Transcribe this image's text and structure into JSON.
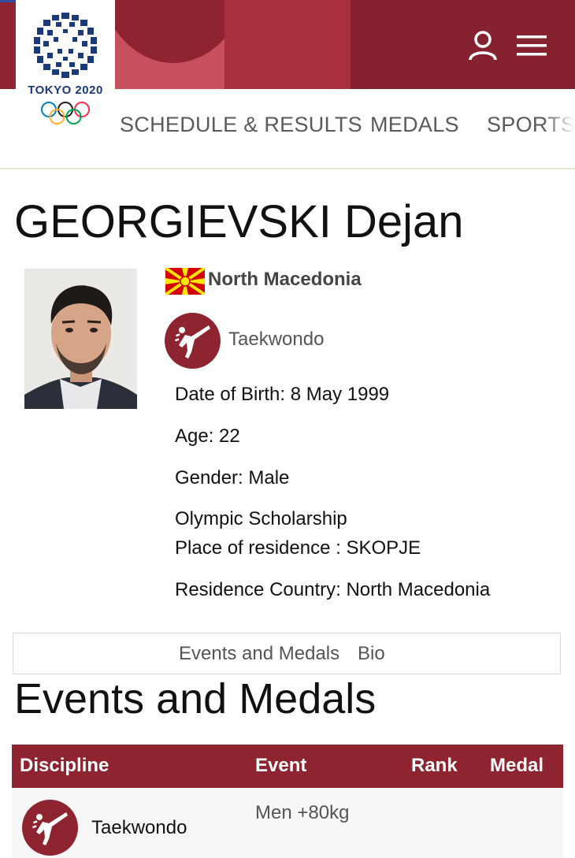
{
  "header": {
    "logo_text": "TOKYO 2020",
    "icons": [
      "user-icon",
      "hamburger-menu-icon"
    ]
  },
  "nav": {
    "items": [
      {
        "label": "SCHEDULE & RESULTS"
      },
      {
        "label": "MEDALS"
      },
      {
        "label": "SPORTS"
      }
    ]
  },
  "athlete": {
    "name": "GEORGIEVSKI Dejan",
    "country": "North Macedonia",
    "sport": "Taekwondo",
    "date_of_birth": "Date of Birth: 8 May 1999",
    "age": "Age: 22",
    "gender": "Gender: Male",
    "scholarship": "Olympic Scholarship",
    "residence_place": "Place of residence : SKOPJE",
    "residence_country": "Residence Country: North Macedonia"
  },
  "tabs": [
    {
      "label": "Events and Medals"
    },
    {
      "label": "Bio"
    }
  ],
  "events_section": {
    "title": "Events and Medals",
    "columns": [
      "Discipline",
      "Event",
      "Rank",
      "Medal"
    ],
    "rows": [
      {
        "discipline": "Taekwondo",
        "event": "Men +80kg",
        "rank": "",
        "medal": ""
      }
    ]
  },
  "colors": {
    "brand_red": "#8e2430",
    "flag_red": "#d20000",
    "flag_yellow": "#ffe600"
  }
}
